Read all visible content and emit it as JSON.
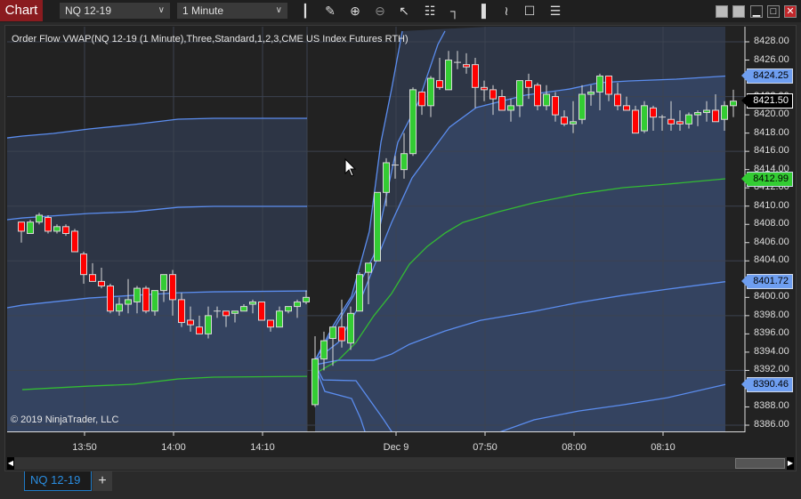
{
  "toolbar": {
    "chart_label": "Chart",
    "instrument": "NQ 12-19",
    "interval": "1 Minute",
    "tools": [
      "bar-type-icon",
      "pencil-icon",
      "zoom-in-icon",
      "zoom-out-icon",
      "pointer-icon",
      "data-box-icon",
      "properties-icon",
      "chart-style-icon",
      "strategy-icon",
      "indicators-icon",
      "list-icon"
    ]
  },
  "indicator_label": "Order Flow VWAP(NQ 12-19 (1 Minute),Three,Standard,1,2,3,CME US Index Futures RTH)",
  "copyright": "© 2019 NinjaTrader, LLC",
  "tabs": {
    "active": "NQ 12-19",
    "add": "+"
  },
  "colors": {
    "up": "#33cc33",
    "down": "#ff0000",
    "band": "#5b8def",
    "vwap": "#33bb33",
    "tag_band": "#6e9ef0",
    "tag_vwap": "#33cc33",
    "brand": "#8a1b1f"
  },
  "chart_data": {
    "type": "candlestick",
    "ylim": [
      8386,
      8428
    ],
    "y_ticks": [
      "8428.00",
      "8426.00",
      "8424.00",
      "8422.00",
      "8420.00",
      "8418.00",
      "8416.00",
      "8414.00",
      "8412.00",
      "8410.00",
      "8408.00",
      "8406.00",
      "8404.00",
      "8402.00",
      "8400.00",
      "8398.00",
      "8396.00",
      "8394.00",
      "8392.00",
      "8390.00",
      "8388.00",
      "8386.00"
    ],
    "x_ticks": [
      "13:50",
      "14:00",
      "14:10",
      "Dec 9",
      "07:50",
      "08:00",
      "08:10"
    ],
    "price_tags": [
      {
        "value": "8424.25",
        "kind": "band"
      },
      {
        "value": "8421.50",
        "kind": "last"
      },
      {
        "value": "8412.99",
        "kind": "vwap"
      },
      {
        "value": "8401.72",
        "kind": "band"
      },
      {
        "value": "8390.46",
        "kind": "band"
      }
    ],
    "sessions": [
      {
        "candles_ohlc": [
          [
            8408.25,
            8408.25,
            8406,
            8407.25
          ],
          [
            8407,
            8408.5,
            8407,
            8408.25
          ],
          [
            8408.25,
            8409.25,
            8408,
            8409
          ],
          [
            8408.75,
            8409,
            8407,
            8407.25
          ],
          [
            8407.25,
            8408,
            8407,
            8407.75
          ],
          [
            8407.75,
            8408,
            8406.75,
            8407
          ],
          [
            8407.25,
            8407.5,
            8405,
            8405
          ],
          [
            8404.75,
            8405,
            8401.5,
            8402.5
          ],
          [
            8402.5,
            8403.75,
            8401.75,
            8401.75
          ],
          [
            8401.75,
            8403.25,
            8401,
            8401.25
          ],
          [
            8401.25,
            8401.5,
            8398.25,
            8398.5
          ],
          [
            8398.5,
            8400,
            8398,
            8399.25
          ],
          [
            8399.25,
            8402,
            8398.25,
            8399.75
          ],
          [
            8399.5,
            8401.25,
            8398.25,
            8401
          ],
          [
            8401,
            8401.25,
            8398.25,
            8398.5
          ],
          [
            8398.5,
            8400.75,
            8398,
            8400.75
          ],
          [
            8400.75,
            8402.5,
            8399.5,
            8402.5
          ],
          [
            8402.5,
            8403,
            8398,
            8399.75
          ],
          [
            8399.75,
            8400.5,
            8396.75,
            8397.25
          ],
          [
            8397.5,
            8399,
            8396.25,
            8397
          ],
          [
            8396.75,
            8398,
            8396,
            8396
          ],
          [
            8396,
            8399,
            8395.5,
            8398
          ],
          [
            8398.5,
            8399,
            8397.75,
            8398.5
          ],
          [
            8398.5,
            8398.5,
            8396.75,
            8398
          ],
          [
            8398.25,
            8398.5,
            8397.25,
            8398.5
          ],
          [
            8398.5,
            8399.25,
            8398.5,
            8399
          ],
          [
            8399.25,
            8399.75,
            8398.25,
            8399.5
          ],
          [
            8399.5,
            8399.5,
            8397.5,
            8397.5
          ],
          [
            8397.5,
            8397.5,
            8396.25,
            8396.75
          ],
          [
            8396.75,
            8399,
            8396.75,
            8398.5
          ],
          [
            8398.5,
            8399,
            8398.25,
            8399
          ],
          [
            8399,
            8399.75,
            8397.75,
            8399.5
          ],
          [
            8399.5,
            8400.75,
            8399.25,
            8400
          ]
        ],
        "bands": [
          {
            "kind": "band",
            "points": [
              [
                -1.6,
                8417.47
              ],
              [
                0.1,
                8417.67
              ],
              [
                3.6,
                8417.96
              ],
              [
                7.6,
                8418.45
              ],
              [
                12.6,
                8418.94
              ],
              [
                17.6,
                8419.52
              ],
              [
                21.6,
                8419.62
              ],
              [
                32.1,
                8419.62
              ]
            ]
          },
          {
            "kind": "band",
            "points": [
              [
                -1.6,
                8408.51
              ],
              [
                0.1,
                8408.7
              ],
              [
                7.6,
                8409.19
              ],
              [
                12.6,
                8409.38
              ],
              [
                17.6,
                8409.87
              ],
              [
                21.6,
                8409.97
              ],
              [
                32.1,
                8409.97
              ]
            ]
          },
          {
            "kind": "band",
            "points": [
              [
                -1.6,
                8398.86
              ],
              [
                0.1,
                8399.15
              ],
              [
                7.6,
                8399.93
              ],
              [
                12.6,
                8400.22
              ],
              [
                17.6,
                8400.51
              ],
              [
                21.6,
                8400.61
              ],
              [
                32.1,
                8400.71
              ]
            ]
          },
          {
            "kind": "vwap",
            "points": [
              [
                0.1,
                8389.89
              ],
              [
                7.6,
                8390.28
              ],
              [
                12.6,
                8390.48
              ],
              [
                17.6,
                8391.06
              ],
              [
                21.6,
                8391.26
              ],
              [
                32.1,
                8391.35
              ]
            ]
          }
        ]
      },
      {
        "candles_ohlc": [
          [
            8388.25,
            8395.75,
            8388,
            8393.25
          ],
          [
            8393.25,
            8396.25,
            8392,
            8395.25
          ],
          [
            8395.5,
            8396.75,
            8392.5,
            8396.75
          ],
          [
            8396.75,
            8399.75,
            8394.5,
            8395.25
          ],
          [
            8395,
            8399,
            8394.25,
            8398.25
          ],
          [
            8398.5,
            8402.75,
            8398.5,
            8402.5
          ],
          [
            8402.75,
            8403.75,
            8399.25,
            8403.75
          ],
          [
            8404,
            8411.5,
            8404,
            8411.5
          ],
          [
            8411.5,
            8415.25,
            8410,
            8414.75
          ],
          [
            8414.5,
            8415.5,
            8413,
            8414.5
          ],
          [
            8414,
            8418,
            8413,
            8415.75
          ],
          [
            8415.75,
            8423,
            8415.5,
            8422.75
          ],
          [
            8422.5,
            8422.5,
            8420,
            8421
          ],
          [
            8421,
            8424.25,
            8419.75,
            8424
          ],
          [
            8423.75,
            8426.25,
            8422.75,
            8423
          ],
          [
            8422.75,
            8427,
            8422.75,
            8426
          ],
          [
            8425.75,
            8427,
            8425,
            8425.75
          ],
          [
            8425.5,
            8426.75,
            8424.5,
            8425.25
          ],
          [
            8425.5,
            8426.25,
            8420.75,
            8423
          ],
          [
            8423,
            8423.75,
            8421.5,
            8422.75
          ],
          [
            8422.75,
            8423.25,
            8420,
            8421.75
          ],
          [
            8422,
            8422.75,
            8420.5,
            8420.5
          ],
          [
            8420.5,
            8421.75,
            8419.25,
            8421
          ],
          [
            8421,
            8423.75,
            8419.75,
            8423.75
          ],
          [
            8423.75,
            8424.5,
            8421.75,
            8423
          ],
          [
            8423.25,
            8423.5,
            8420.5,
            8421
          ],
          [
            8421,
            8423.25,
            8420.5,
            8422.25
          ],
          [
            8422,
            8422.5,
            8419.25,
            8420
          ],
          [
            8419.75,
            8420.5,
            8418.75,
            8419
          ],
          [
            8419,
            8421.5,
            8418,
            8419.25
          ],
          [
            8419.5,
            8423.25,
            8419,
            8422.25
          ],
          [
            8422.25,
            8423.25,
            8421,
            8422.5
          ],
          [
            8422.5,
            8424.5,
            8420.5,
            8424.25
          ],
          [
            8424.25,
            8424.25,
            8421.5,
            8422.25
          ],
          [
            8422.25,
            8423.5,
            8420.5,
            8421
          ],
          [
            8421,
            8422,
            8420.5,
            8420.5
          ],
          [
            8420.5,
            8421,
            8418,
            8418
          ],
          [
            8418.25,
            8421.5,
            8418,
            8421
          ],
          [
            8420.75,
            8421,
            8418.25,
            8419.75
          ],
          [
            8419.75,
            8420,
            8418.25,
            8419.75
          ],
          [
            8419.5,
            8421.5,
            8418.25,
            8419
          ],
          [
            8419.25,
            8420.5,
            8418.25,
            8419
          ],
          [
            8419,
            8420.25,
            8418.5,
            8420
          ],
          [
            8420,
            8420.5,
            8418.75,
            8420.25
          ],
          [
            8420.25,
            8421.5,
            8419.25,
            8420.5
          ],
          [
            8420.5,
            8422.25,
            8419.25,
            8419.25
          ],
          [
            8419.5,
            8421.5,
            8418.25,
            8421
          ],
          [
            8421,
            8422.75,
            8419.75,
            8421.5
          ]
        ],
        "bands": [
          {
            "kind": "band",
            "points": [
              [
                0,
                8393.11
              ],
              [
                2.1,
                8397.01
              ],
              [
                4.1,
                8400.12
              ],
              [
                6.1,
                8407.24
              ],
              [
                7.4,
                8416.99
              ],
              [
                8.6,
                8422.83
              ],
              [
                9.8,
                8429.17
              ]
            ]
          },
          {
            "kind": "band",
            "points": [
              [
                0,
                8393.11
              ],
              [
                2.1,
                8396.52
              ],
              [
                4.3,
                8400.12
              ],
              [
                6.6,
                8404.61
              ],
              [
                9.3,
                8416.99
              ],
              [
                11.6,
                8421.37
              ],
              [
                13.8,
                8427.71
              ],
              [
                14.6,
                8429.17
              ]
            ]
          },
          {
            "kind": "band",
            "points": [
              [
                0,
                8393.11
              ],
              [
                2.6,
                8395.06
              ],
              [
                4.6,
                8398.47
              ],
              [
                6.6,
                8403.34
              ],
              [
                8.6,
                8408.21
              ],
              [
                10.9,
                8413.09
              ],
              [
                15.1,
                8418.64
              ],
              [
                18.1,
                8420.79
              ],
              [
                23.6,
                8422.15
              ],
              [
                28.6,
                8422.83
              ],
              [
                31.9,
                8423.52
              ],
              [
                35.3,
                8423.71
              ],
              [
                40.6,
                8423.91
              ],
              [
                46.1,
                8424.25
              ]
            ]
          },
          {
            "kind": "vwap",
            "points": [
              [
                0,
                8391.65
              ],
              [
                2.6,
                8393.11
              ],
              [
                4.6,
                8395.06
              ],
              [
                6.6,
                8397.98
              ],
              [
                8.6,
                8400.42
              ],
              [
                10.6,
                8403.63
              ],
              [
                12.6,
                8405.58
              ],
              [
                14.6,
                8407.04
              ],
              [
                16.6,
                8408.21
              ],
              [
                20.6,
                8409.38
              ],
              [
                24.6,
                8410.36
              ],
              [
                29.6,
                8411.33
              ],
              [
                34.6,
                8412.02
              ],
              [
                39.6,
                8412.41
              ],
              [
                46.1,
                8412.99
              ]
            ]
          },
          {
            "kind": "band",
            "points": [
              [
                0,
                8392.62
              ],
              [
                2.6,
                8393.11
              ],
              [
                4.6,
                8393.11
              ],
              [
                6.6,
                8393.11
              ],
              [
                8.6,
                8393.79
              ],
              [
                10.6,
                8394.86
              ],
              [
                14.6,
                8396.32
              ],
              [
                18.6,
                8397.49
              ],
              [
                24.6,
                8398.47
              ],
              [
                29.6,
                8399.44
              ],
              [
                34.6,
                8400.22
              ],
              [
                39.6,
                8400.9
              ],
              [
                46.1,
                8401.72
              ]
            ]
          },
          {
            "kind": "band",
            "points": [
              [
                0,
                8392.62
              ],
              [
                0.9,
                8390.96
              ],
              [
                4.6,
                8390.87
              ],
              [
                7.6,
                8386.77
              ],
              [
                9.6,
                8383.85
              ],
              [
                14.6,
                8382.87
              ],
              [
                20.1,
                8385.02
              ],
              [
                24.6,
                8386.58
              ],
              [
                29.6,
                8387.55
              ],
              [
                34.6,
                8388.23
              ],
              [
                39.6,
                8389.01
              ],
              [
                46.1,
                8390.46
              ]
            ]
          },
          {
            "kind": "band",
            "points": [
              [
                0,
                8392.43
              ],
              [
                1.1,
                8389.7
              ],
              [
                4.1,
                8388.92
              ],
              [
                5.1,
                8386.77
              ],
              [
                6.1,
                8383.85
              ],
              [
                10.6,
                8378.0
              ]
            ]
          }
        ]
      }
    ]
  }
}
